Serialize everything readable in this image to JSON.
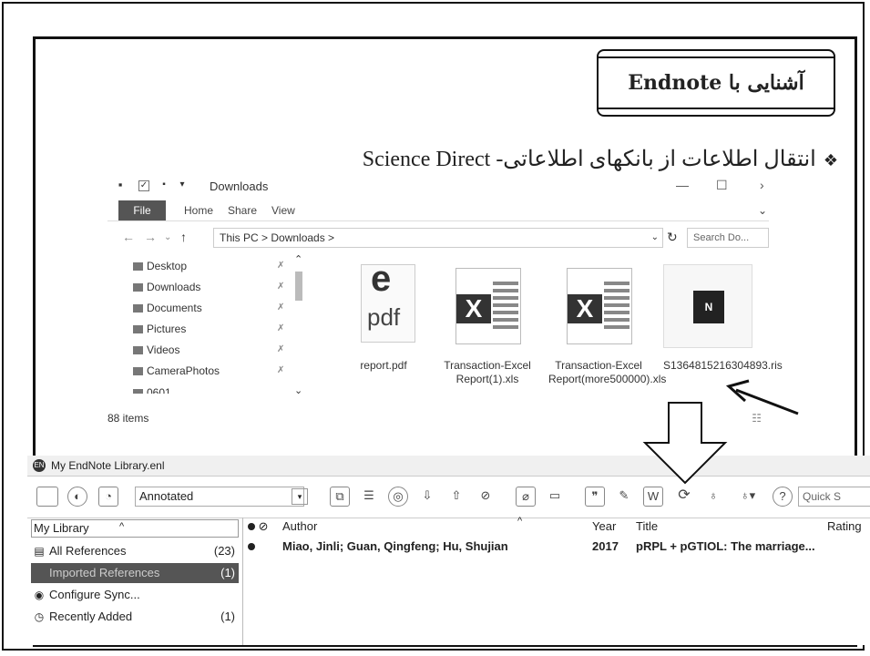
{
  "slide": {
    "title": "آشنایی با Endnote",
    "bullet": "انتقال اطلاعات از بانکهای اطلاعاتی- Science Direct",
    "bullet_marker": "❖"
  },
  "explorer": {
    "title": "Downloads",
    "ribbon_tabs": [
      "File",
      "Home",
      "Share",
      "View"
    ],
    "address": "This PC  >  Downloads  >",
    "search_placeholder": "Search Do...",
    "nav_items": [
      "Desktop",
      "Downloads",
      "Documents",
      "Pictures",
      "Videos",
      "CameraPhotos",
      "0601"
    ],
    "files": [
      {
        "name": "report.pdf",
        "icon": "pdf-file-icon"
      },
      {
        "name": "Transaction-Excel Report(1).xls",
        "icon": "excel-file-icon"
      },
      {
        "name": "Transaction-Excel Report(more500000).xls",
        "icon": "excel-file-icon"
      },
      {
        "name": "S1364815216304893.ris",
        "icon": "ris-file-icon"
      }
    ],
    "status": "88 items"
  },
  "endnote": {
    "title": "My EndNote Library.enl",
    "style": "Annotated",
    "quick_search": "Quick S",
    "groups_header": "My Library",
    "groups": [
      {
        "label": "All References",
        "count": "(23)",
        "icon": "library-icon"
      },
      {
        "label": "Imported References",
        "count": "(1)",
        "icon": "import-icon"
      },
      {
        "label": "Configure Sync...",
        "count": "",
        "icon": "sync-icon"
      },
      {
        "label": "Recently Added",
        "count": "(1)",
        "icon": "clock-icon"
      }
    ],
    "columns": {
      "author": "Author",
      "year": "Year",
      "title": "Title",
      "rating": "Rating"
    },
    "references": [
      {
        "author": "Miao, Jinli; Guan, Qingfeng; Hu, Shujian",
        "year": "2017",
        "title": "pRPL + pGTIOL: The marriage..."
      }
    ]
  }
}
